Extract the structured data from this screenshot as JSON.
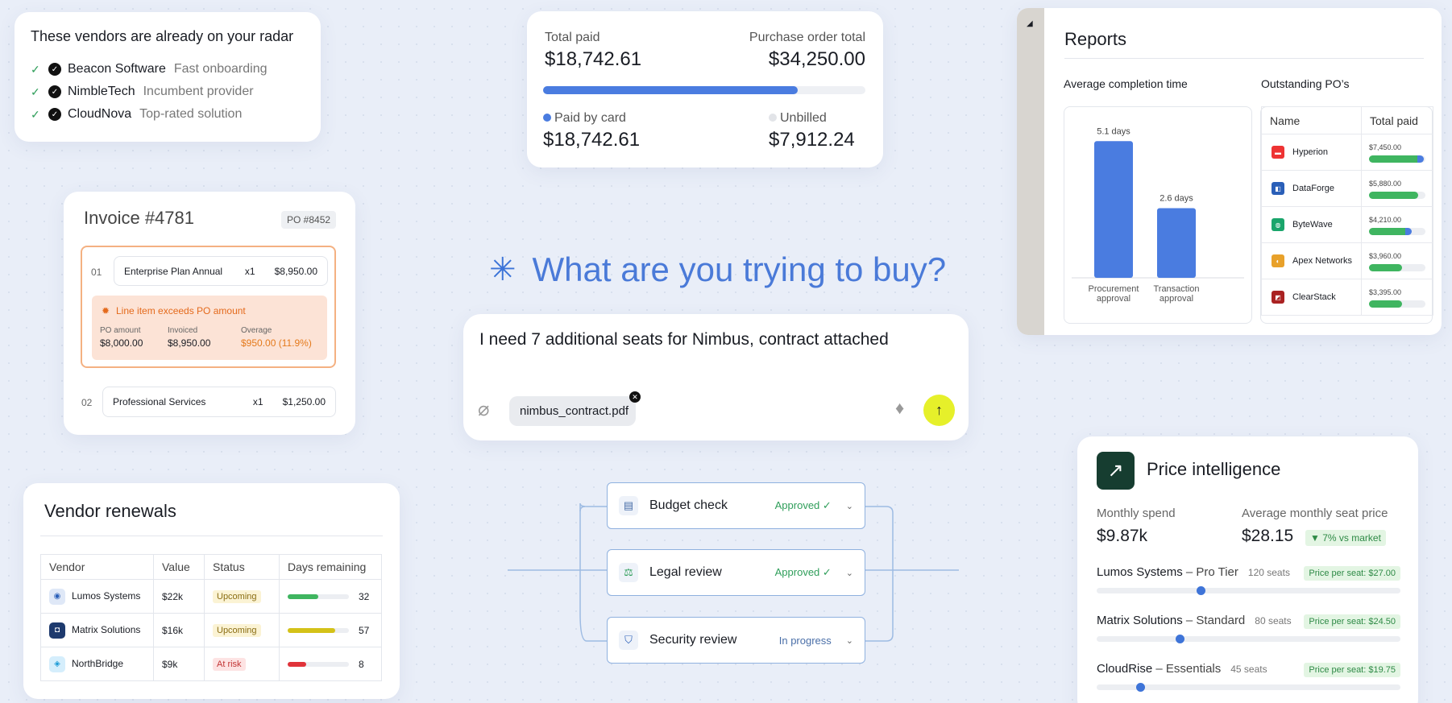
{
  "radar": {
    "title": "These vendors are already on your radar",
    "items": [
      {
        "name": "Beacon Software",
        "tag": "Fast onboarding"
      },
      {
        "name": "NimbleTech",
        "tag": "Incumbent provider"
      },
      {
        "name": "CloudNova",
        "tag": "Top-rated solution"
      }
    ]
  },
  "paid": {
    "total_label": "Total paid",
    "total_value": "$18,742.61",
    "po_label": "Purchase order total",
    "po_value": "$34,250.00",
    "progress": 0.79,
    "card_label": "Paid by card",
    "card_value": "$18,742.61",
    "unbilled_label": "Unbilled",
    "unbilled_value": "$7,912.24"
  },
  "invoice": {
    "title": "Invoice #4781",
    "po": "PO #8452",
    "line1": {
      "num": "01",
      "name": "Enterprise Plan Annual",
      "qty": "x1",
      "amount": "$8,950.00"
    },
    "warning": "Line item exceeds PO amount",
    "po_amount_label": "PO amount",
    "po_amount": "$8,000.00",
    "invoiced_label": "Invoiced",
    "invoiced": "$8,950.00",
    "overage_label": "Overage",
    "overage": "$950.00 (11.9%)",
    "line2": {
      "num": "02",
      "name": "Professional Services",
      "qty": "x1",
      "amount": "$1,250.00"
    }
  },
  "ask": {
    "title": "What are you trying to buy?"
  },
  "prompt": {
    "text": "I need 7 additional seats for Nimbus, contract attached",
    "attachment": "nimbus_contract.pdf"
  },
  "workflow": [
    {
      "name": "Budget check",
      "status": "Approved ✓"
    },
    {
      "name": "Legal review",
      "status": "Approved ✓"
    },
    {
      "name": "Security review",
      "status": "In progress"
    }
  ],
  "renewals": {
    "title": "Vendor renewals",
    "headers": [
      "Vendor",
      "Value",
      "Status",
      "Days remaining"
    ],
    "rows": [
      {
        "vendor": "Lumos Systems",
        "value": "$22k",
        "status": "Upcoming",
        "days": "32",
        "fill": 0.5
      },
      {
        "vendor": "Matrix Solutions",
        "value": "$16k",
        "status": "Upcoming",
        "days": "57",
        "fill": 0.78
      },
      {
        "vendor": "NorthBridge",
        "value": "$9k",
        "status": "At risk",
        "days": "8",
        "fill": 0.3
      }
    ]
  },
  "reports": {
    "title": "Reports",
    "chart_title": "Average completion time",
    "po_title": "Outstanding PO’s",
    "name_header": "Name",
    "paid_header": "Total paid",
    "pos": [
      {
        "name": "Hyperion",
        "paid": "$7,450.00",
        "fill": 0.93,
        "extra": true
      },
      {
        "name": "DataForge",
        "paid": "$5,880.00",
        "fill": 0.87,
        "extra": false
      },
      {
        "name": "ByteWave",
        "paid": "$4,210.00",
        "fill": 0.72,
        "extra": true
      },
      {
        "name": "Apex Networks",
        "paid": "$3,960.00",
        "fill": 0.58,
        "extra": false
      },
      {
        "name": "ClearStack",
        "paid": "$3,395.00",
        "fill": 0.58,
        "extra": false
      }
    ]
  },
  "chart_data": {
    "type": "bar",
    "title": "Average completion time",
    "categories": [
      "Procurement approval",
      "Transaction approval"
    ],
    "values": [
      5.1,
      2.6
    ],
    "data_labels": [
      "5.1 days",
      "2.6 days"
    ],
    "ylim": [
      0,
      5.5
    ],
    "color": "#4a7ce0"
  },
  "price": {
    "title": "Price intelligence",
    "spend_label": "Monthly spend",
    "spend": "$9.87k",
    "seat_label": "Average monthly seat price",
    "seat": "$28.15",
    "delta": "▼ 7% vs market",
    "rows": [
      {
        "vendor": "Lumos Systems",
        "plan": " – Pro Tier",
        "seats": "120 seats",
        "tag": "Price per seat: $27.00",
        "pos": 0.33
      },
      {
        "vendor": "Matrix Solutions",
        "plan": " – Standard",
        "seats": "80 seats",
        "tag": "Price per seat: $24.50",
        "pos": 0.26
      },
      {
        "vendor": "CloudRise",
        "plan": " – Essentials",
        "seats": "45 seats",
        "tag": "Price per seat: $19.75",
        "pos": 0.13
      }
    ]
  }
}
